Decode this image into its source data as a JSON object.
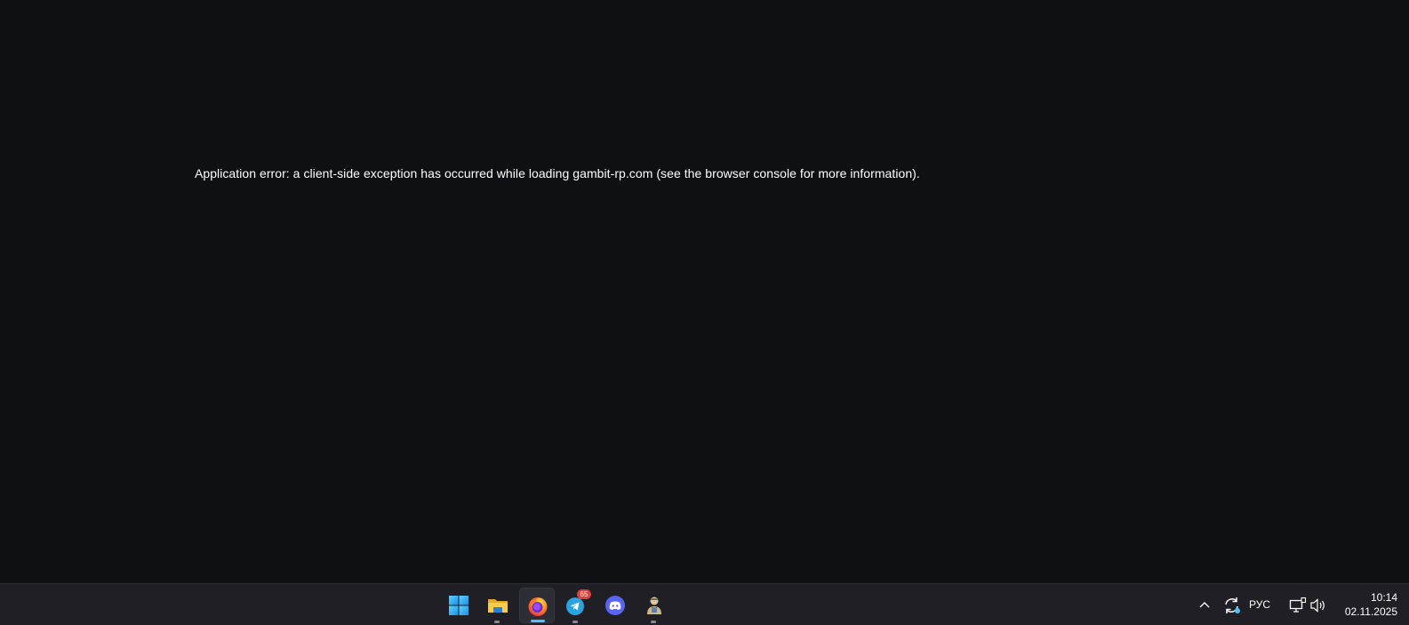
{
  "browser": {
    "error_message": "Application error: a client-side exception has occurred while loading gambit-rp.com (see the browser console for more information)."
  },
  "taskbar": {
    "apps": [
      {
        "name": "Start",
        "icon": "windows-start-icon",
        "running": false,
        "active": false
      },
      {
        "name": "File Explorer",
        "icon": "folder-icon",
        "running": true,
        "active": false
      },
      {
        "name": "Firefox",
        "icon": "firefox-icon",
        "running": true,
        "active": true
      },
      {
        "name": "Telegram",
        "icon": "telegram-icon",
        "running": true,
        "active": false,
        "badge": "65"
      },
      {
        "name": "Discord",
        "icon": "discord-icon",
        "running": false,
        "active": false
      },
      {
        "name": "App",
        "icon": "user-app-icon",
        "running": true,
        "active": false
      }
    ],
    "tray": {
      "language": "РУС",
      "time": "10:14",
      "date": "02.11.2025"
    }
  },
  "colors": {
    "background": "#0f1014",
    "taskbar": "#1f1f25",
    "accent": "#4cc2ff",
    "badge": "#e0403a"
  }
}
